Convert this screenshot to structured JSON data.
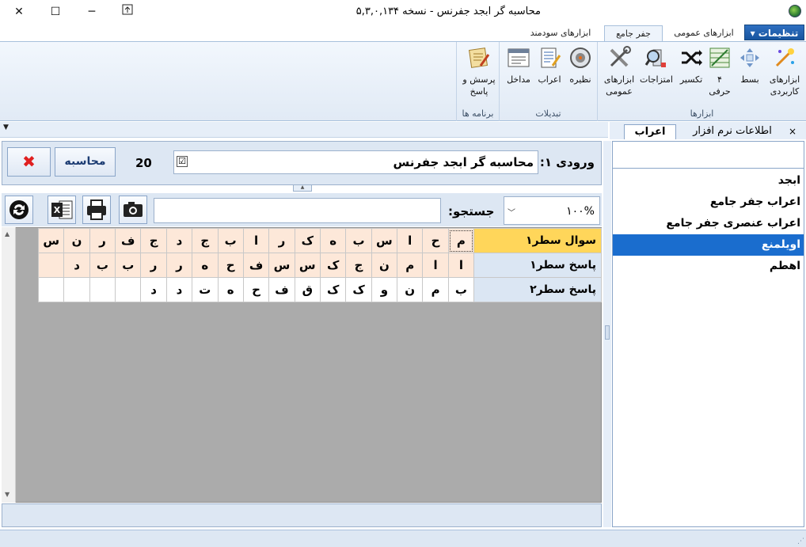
{
  "window": {
    "title": "محاسبه گر ابجد جفرنس - نسخه ۵,۳,۰,۱۳۴"
  },
  "ribbon": {
    "menu_label": "تنظیمات ▾",
    "tabs": [
      "ابزارهای عمومی",
      "جفر جامع",
      "ابزارهای سودمند"
    ],
    "groups": {
      "tools": {
        "label": "ابزارها",
        "buttons": [
          "ابزارهای کاربردی",
          "بسط",
          "۴ حرفی",
          "تکسیر",
          "امتزاجات",
          "ابزارهای عمومی"
        ]
      },
      "transforms": {
        "label": "تبدیلات",
        "buttons": [
          "نظیره",
          "اعراب",
          "مداخل"
        ]
      },
      "programs": {
        "label": "برنامه ها",
        "buttons": [
          "پرسش و پاسخ"
        ]
      }
    }
  },
  "panel": {
    "tabs": [
      "اطلاعات نرم افزار",
      "اعراب"
    ],
    "close_symbol": "×",
    "items": [
      "ابجد",
      "اعراب جفر جامع",
      "اعراب عنصری جفر جامع",
      "اویلمنع",
      "اهطم"
    ],
    "selected_index": 3
  },
  "input": {
    "label": "ورودی ۱:",
    "value": "محاسبه گر ابجد جفرنس",
    "count": "20",
    "checked_symbol": "☑",
    "calculate_label": "محاسبه",
    "cancel_symbol": "✖"
  },
  "toolbar": {
    "search_label": "جستجو:",
    "search_value": "",
    "zoom": "۱۰۰%"
  },
  "grid": {
    "rows": [
      {
        "label": "سوال سطر۱",
        "cells": [
          "م",
          "ح",
          "ا",
          "س",
          "ب",
          "ه",
          "ک",
          "ر",
          "ا",
          "ب",
          "ج",
          "د",
          "ج",
          "ف",
          "ر",
          "ن",
          "س"
        ]
      },
      {
        "label": "پاسخ سطر۱",
        "cells": [
          "ا",
          "ا",
          "م",
          "ن",
          "ج",
          "ک",
          "س",
          "س",
          "ف",
          "ح",
          "ه",
          "ر",
          "ر",
          "ب",
          "ب",
          "د",
          ""
        ]
      },
      {
        "label": "پاسخ سطر۲",
        "cells": [
          "ب",
          "م",
          "ن",
          "و",
          "ک",
          "ک",
          "ق",
          "ف",
          "ح",
          "ه",
          "ت",
          "د",
          "د",
          "",
          "",
          "",
          ""
        ]
      }
    ]
  },
  "colors": {
    "selection_blue": "#1a6dce",
    "header_yellow": "#ffd65a",
    "cell_peach": "#fde8d9",
    "grid_gray": "#ababab"
  }
}
